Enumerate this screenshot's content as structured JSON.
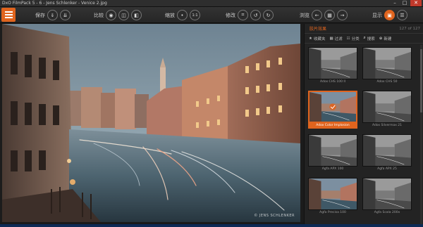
{
  "window": {
    "title": "DxO FilmPack 5 - 6 - Jens Schlenker - Venice 2.jpg",
    "controls": [
      "–",
      "□",
      "✕"
    ]
  },
  "toolbar": {
    "save_label": "保存",
    "compare_label": "比较",
    "zoom_label": "缩放",
    "zoom_ratio": "1:1",
    "edit_label": "修改",
    "browse_label": "浏览",
    "display_label": "显示"
  },
  "photo": {
    "watermark": "© JENS SCHLENKER"
  },
  "panel": {
    "title": "胶片效果",
    "count": "127 of 127",
    "tabs": [
      {
        "icon": "★",
        "label": "收藏夹"
      },
      {
        "icon": "▦",
        "label": "过滤"
      },
      {
        "icon": "☷",
        "label": "分类"
      },
      {
        "icon": "⌕",
        "label": "搜索"
      },
      {
        "icon": "⊕",
        "label": "新建"
      }
    ],
    "thumbnails": [
      {
        "label": "Adox CHS 100 II",
        "style": "bw",
        "selected": false
      },
      {
        "label": "Adox CHS 50",
        "style": "bw",
        "selected": false
      },
      {
        "label": "Adox Color Implosion",
        "style": "color",
        "selected": true
      },
      {
        "label": "Adox Silvermax 21",
        "style": "bw",
        "selected": false
      },
      {
        "label": "Agfa APX 100",
        "style": "bw",
        "selected": false
      },
      {
        "label": "Agfa APX 25",
        "style": "bw",
        "selected": false
      },
      {
        "label": "Agfa Precisa 100",
        "style": "color",
        "selected": false
      },
      {
        "label": "Agfa Scala 200x",
        "style": "bw",
        "selected": false
      }
    ]
  },
  "colors": {
    "accent": "#e0641e",
    "background": "#1c1c1c",
    "panel": "#232323"
  }
}
